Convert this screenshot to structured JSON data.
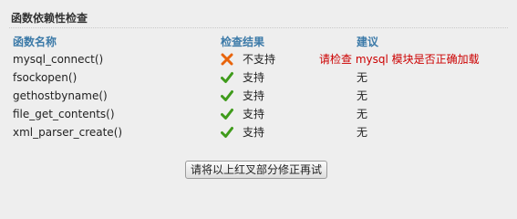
{
  "section": {
    "title": "函数依赖性检查"
  },
  "columns": {
    "name": "函数名称",
    "result": "检查结果",
    "suggestion": "建议"
  },
  "rows": [
    {
      "name": "mysql_connect()",
      "status": "fail",
      "result": "不支持",
      "suggestion": "请检查 mysql 模块是否正确加载",
      "icon": "red-x-icon"
    },
    {
      "name": "fsockopen()",
      "status": "ok",
      "result": "支持",
      "suggestion": "无",
      "icon": "green-check-icon"
    },
    {
      "name": "gethostbyname()",
      "status": "ok",
      "result": "支持",
      "suggestion": "无",
      "icon": "green-check-icon"
    },
    {
      "name": "file_get_contents()",
      "status": "ok",
      "result": "支持",
      "suggestion": "无",
      "icon": "green-check-icon"
    },
    {
      "name": "xml_parser_create()",
      "status": "ok",
      "result": "支持",
      "suggestion": "无",
      "icon": "green-check-icon"
    }
  ],
  "actions": {
    "recheck_label": "请将以上红叉部分修正再试"
  },
  "colors": {
    "header_text": "#3c7aa8",
    "warning_text": "#cc0000",
    "check_green": "#3f9b1b",
    "cross_orange": "#e8640c"
  }
}
